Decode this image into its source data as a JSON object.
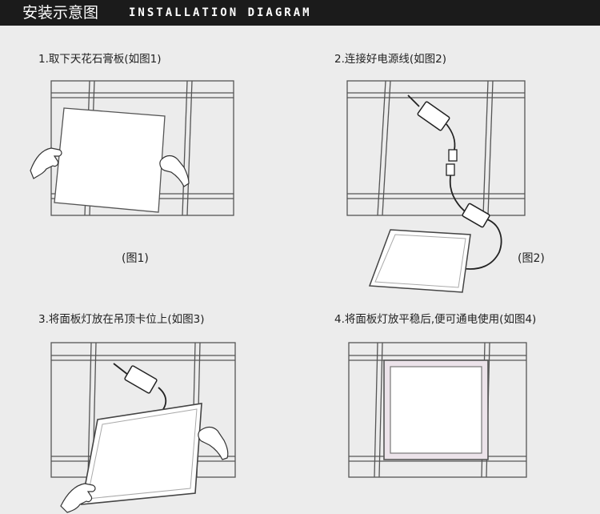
{
  "header": {
    "title_cn": "安装示意图",
    "title_en": "INSTALLATION DIAGRAM"
  },
  "steps": [
    {
      "label": "1.取下天花石膏板(如图1)",
      "figure": "(图1)"
    },
    {
      "label": "2.连接好电源线(如图2)",
      "figure": "(图2)"
    },
    {
      "label": "3.将面板灯放在吊顶卡位上(如图3)"
    },
    {
      "label": "4.将面板灯放平稳后,便可通电使用(如图4)"
    }
  ],
  "colors": {
    "header_bg": "#1b1b1b",
    "background": "#ececec",
    "line": "#555555"
  }
}
